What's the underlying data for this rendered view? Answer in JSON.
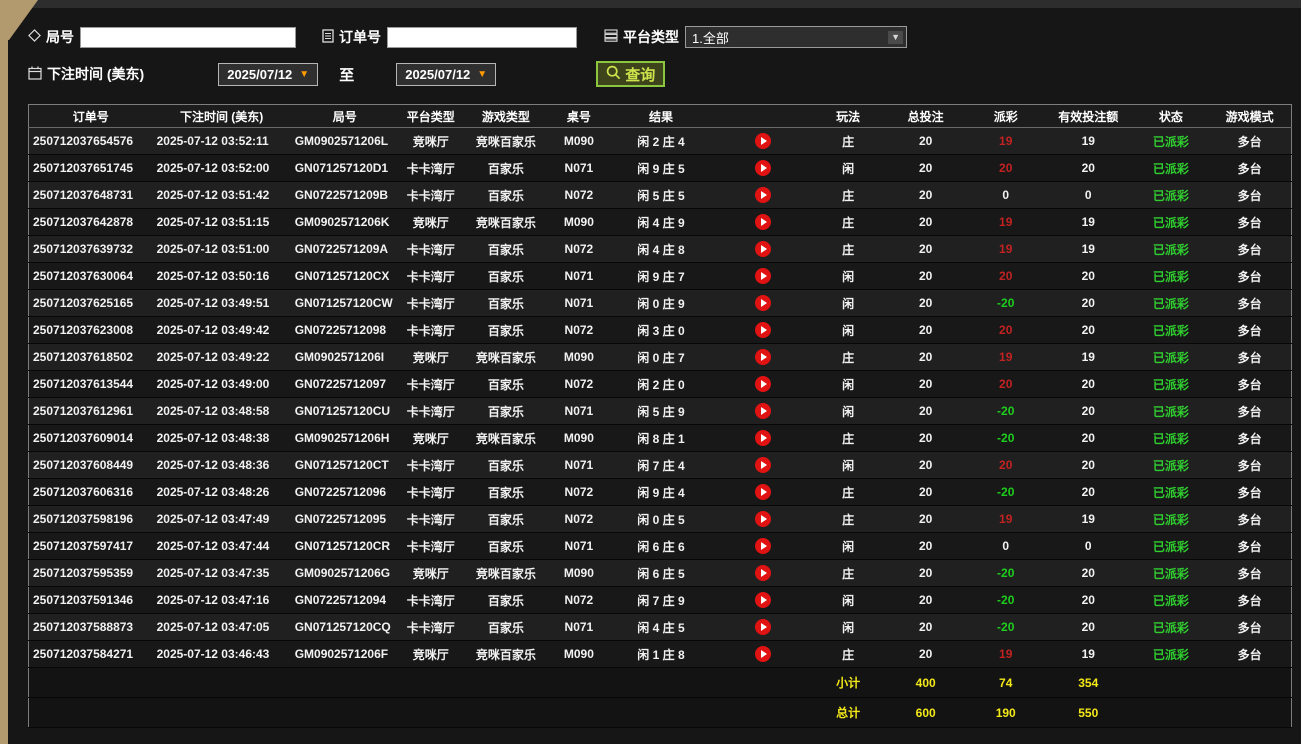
{
  "filters": {
    "round": {
      "label": "局号",
      "value": "",
      "icon": "tag-icon"
    },
    "order": {
      "label": "订单号",
      "value": "",
      "icon": "document-icon"
    },
    "platform": {
      "label": "平台类型",
      "value": "1.全部",
      "icon": "list-icon"
    },
    "bet_time": {
      "label": "下注时间 (美东)",
      "from": "2025/07/12",
      "to_label": "至",
      "to": "2025/07/12",
      "icon": "calendar-icon"
    },
    "query": {
      "label": "查询",
      "icon": "search-icon"
    }
  },
  "table": {
    "headers": [
      "订单号",
      "下注时间 (美东)",
      "局号",
      "平台类型",
      "游戏类型",
      "桌号",
      "结果",
      "",
      "玩法",
      "总投注",
      "派彩",
      "有效投注额",
      "状态",
      "游戏模式"
    ],
    "rows": [
      {
        "order": "250712037654576",
        "time": "2025-07-12 03:52:11",
        "round": "GM0902571206L",
        "platform": "竞咪厅",
        "game": "竞咪百家乐",
        "table_no": "M090",
        "result": "闲 2 庄 4",
        "play": "庄",
        "total_bet": "20",
        "payout": "19",
        "payout_color": "red",
        "valid_bet": "19",
        "status": "已派彩",
        "mode": "多台"
      },
      {
        "order": "250712037651745",
        "time": "2025-07-12 03:52:00",
        "round": "GN071257120D1",
        "platform": "卡卡湾厅",
        "game": "百家乐",
        "table_no": "N071",
        "result": "闲 9 庄 5",
        "play": "闲",
        "total_bet": "20",
        "payout": "20",
        "payout_color": "red",
        "valid_bet": "20",
        "status": "已派彩",
        "mode": "多台"
      },
      {
        "order": "250712037648731",
        "time": "2025-07-12 03:51:42",
        "round": "GN0722571209B",
        "platform": "卡卡湾厅",
        "game": "百家乐",
        "table_no": "N072",
        "result": "闲 5 庄 5",
        "play": "庄",
        "total_bet": "20",
        "payout": "0",
        "payout_color": "white",
        "valid_bet": "0",
        "status": "已派彩",
        "mode": "多台"
      },
      {
        "order": "250712037642878",
        "time": "2025-07-12 03:51:15",
        "round": "GM0902571206K",
        "platform": "竞咪厅",
        "game": "竞咪百家乐",
        "table_no": "M090",
        "result": "闲 4 庄 9",
        "play": "庄",
        "total_bet": "20",
        "payout": "19",
        "payout_color": "red",
        "valid_bet": "19",
        "status": "已派彩",
        "mode": "多台"
      },
      {
        "order": "250712037639732",
        "time": "2025-07-12 03:51:00",
        "round": "GN0722571209A",
        "platform": "卡卡湾厅",
        "game": "百家乐",
        "table_no": "N072",
        "result": "闲 4 庄 8",
        "play": "庄",
        "total_bet": "20",
        "payout": "19",
        "payout_color": "red",
        "valid_bet": "19",
        "status": "已派彩",
        "mode": "多台"
      },
      {
        "order": "250712037630064",
        "time": "2025-07-12 03:50:16",
        "round": "GN071257120CX",
        "platform": "卡卡湾厅",
        "game": "百家乐",
        "table_no": "N071",
        "result": "闲 9 庄 7",
        "play": "闲",
        "total_bet": "20",
        "payout": "20",
        "payout_color": "red",
        "valid_bet": "20",
        "status": "已派彩",
        "mode": "多台"
      },
      {
        "order": "250712037625165",
        "time": "2025-07-12 03:49:51",
        "round": "GN071257120CW",
        "platform": "卡卡湾厅",
        "game": "百家乐",
        "table_no": "N071",
        "result": "闲 0 庄 9",
        "play": "闲",
        "total_bet": "20",
        "payout": "-20",
        "payout_color": "green",
        "valid_bet": "20",
        "status": "已派彩",
        "mode": "多台"
      },
      {
        "order": "250712037623008",
        "time": "2025-07-12 03:49:42",
        "round": "GN07225712098",
        "platform": "卡卡湾厅",
        "game": "百家乐",
        "table_no": "N072",
        "result": "闲 3 庄 0",
        "play": "闲",
        "total_bet": "20",
        "payout": "20",
        "payout_color": "red",
        "valid_bet": "20",
        "status": "已派彩",
        "mode": "多台"
      },
      {
        "order": "250712037618502",
        "time": "2025-07-12 03:49:22",
        "round": "GM0902571206I",
        "platform": "竞咪厅",
        "game": "竞咪百家乐",
        "table_no": "M090",
        "result": "闲 0 庄 7",
        "play": "庄",
        "total_bet": "20",
        "payout": "19",
        "payout_color": "red",
        "valid_bet": "19",
        "status": "已派彩",
        "mode": "多台"
      },
      {
        "order": "250712037613544",
        "time": "2025-07-12 03:49:00",
        "round": "GN07225712097",
        "platform": "卡卡湾厅",
        "game": "百家乐",
        "table_no": "N072",
        "result": "闲 2 庄 0",
        "play": "闲",
        "total_bet": "20",
        "payout": "20",
        "payout_color": "red",
        "valid_bet": "20",
        "status": "已派彩",
        "mode": "多台"
      },
      {
        "order": "250712037612961",
        "time": "2025-07-12 03:48:58",
        "round": "GN071257120CU",
        "platform": "卡卡湾厅",
        "game": "百家乐",
        "table_no": "N071",
        "result": "闲 5 庄 9",
        "play": "闲",
        "total_bet": "20",
        "payout": "-20",
        "payout_color": "green",
        "valid_bet": "20",
        "status": "已派彩",
        "mode": "多台"
      },
      {
        "order": "250712037609014",
        "time": "2025-07-12 03:48:38",
        "round": "GM0902571206H",
        "platform": "竞咪厅",
        "game": "竞咪百家乐",
        "table_no": "M090",
        "result": "闲 8 庄 1",
        "play": "庄",
        "total_bet": "20",
        "payout": "-20",
        "payout_color": "green",
        "valid_bet": "20",
        "status": "已派彩",
        "mode": "多台"
      },
      {
        "order": "250712037608449",
        "time": "2025-07-12 03:48:36",
        "round": "GN071257120CT",
        "platform": "卡卡湾厅",
        "game": "百家乐",
        "table_no": "N071",
        "result": "闲 7 庄 4",
        "play": "闲",
        "total_bet": "20",
        "payout": "20",
        "payout_color": "red",
        "valid_bet": "20",
        "status": "已派彩",
        "mode": "多台"
      },
      {
        "order": "250712037606316",
        "time": "2025-07-12 03:48:26",
        "round": "GN07225712096",
        "platform": "卡卡湾厅",
        "game": "百家乐",
        "table_no": "N072",
        "result": "闲 9 庄 4",
        "play": "庄",
        "total_bet": "20",
        "payout": "-20",
        "payout_color": "green",
        "valid_bet": "20",
        "status": "已派彩",
        "mode": "多台"
      },
      {
        "order": "250712037598196",
        "time": "2025-07-12 03:47:49",
        "round": "GN07225712095",
        "platform": "卡卡湾厅",
        "game": "百家乐",
        "table_no": "N072",
        "result": "闲 0 庄 5",
        "play": "庄",
        "total_bet": "20",
        "payout": "19",
        "payout_color": "red",
        "valid_bet": "19",
        "status": "已派彩",
        "mode": "多台"
      },
      {
        "order": "250712037597417",
        "time": "2025-07-12 03:47:44",
        "round": "GN071257120CR",
        "platform": "卡卡湾厅",
        "game": "百家乐",
        "table_no": "N071",
        "result": "闲 6 庄 6",
        "play": "闲",
        "total_bet": "20",
        "payout": "0",
        "payout_color": "white",
        "valid_bet": "0",
        "status": "已派彩",
        "mode": "多台"
      },
      {
        "order": "250712037595359",
        "time": "2025-07-12 03:47:35",
        "round": "GM0902571206G",
        "platform": "竞咪厅",
        "game": "竞咪百家乐",
        "table_no": "M090",
        "result": "闲 6 庄 5",
        "play": "庄",
        "total_bet": "20",
        "payout": "-20",
        "payout_color": "green",
        "valid_bet": "20",
        "status": "已派彩",
        "mode": "多台"
      },
      {
        "order": "250712037591346",
        "time": "2025-07-12 03:47:16",
        "round": "GN07225712094",
        "platform": "卡卡湾厅",
        "game": "百家乐",
        "table_no": "N072",
        "result": "闲 7 庄 9",
        "play": "闲",
        "total_bet": "20",
        "payout": "-20",
        "payout_color": "green",
        "valid_bet": "20",
        "status": "已派彩",
        "mode": "多台"
      },
      {
        "order": "250712037588873",
        "time": "2025-07-12 03:47:05",
        "round": "GN071257120CQ",
        "platform": "卡卡湾厅",
        "game": "百家乐",
        "table_no": "N071",
        "result": "闲 4 庄 5",
        "play": "闲",
        "total_bet": "20",
        "payout": "-20",
        "payout_color": "green",
        "valid_bet": "20",
        "status": "已派彩",
        "mode": "多台"
      },
      {
        "order": "250712037584271",
        "time": "2025-07-12 03:46:43",
        "round": "GM0902571206F",
        "platform": "竞咪厅",
        "game": "竞咪百家乐",
        "table_no": "M090",
        "result": "闲 1 庄 8",
        "play": "庄",
        "total_bet": "20",
        "payout": "19",
        "payout_color": "red",
        "valid_bet": "19",
        "status": "已派彩",
        "mode": "多台"
      }
    ],
    "subtotal": {
      "label": "小计",
      "total_bet": "400",
      "payout": "74",
      "valid_bet": "354"
    },
    "total": {
      "label": "总计",
      "total_bet": "600",
      "payout": "190",
      "valid_bet": "550"
    }
  },
  "colors": {
    "payout_win": "#c32222",
    "payout_loss": "#1dcf1d",
    "payout_zero": "#f2f2f2",
    "status_paid": "#2fce2f",
    "totals_text": "#f4e918",
    "frame_tan": "#b3996e",
    "query_green": "#8cc63f",
    "date_arrow_orange": "#ff9c00",
    "play_icon_red": "#e01212"
  }
}
